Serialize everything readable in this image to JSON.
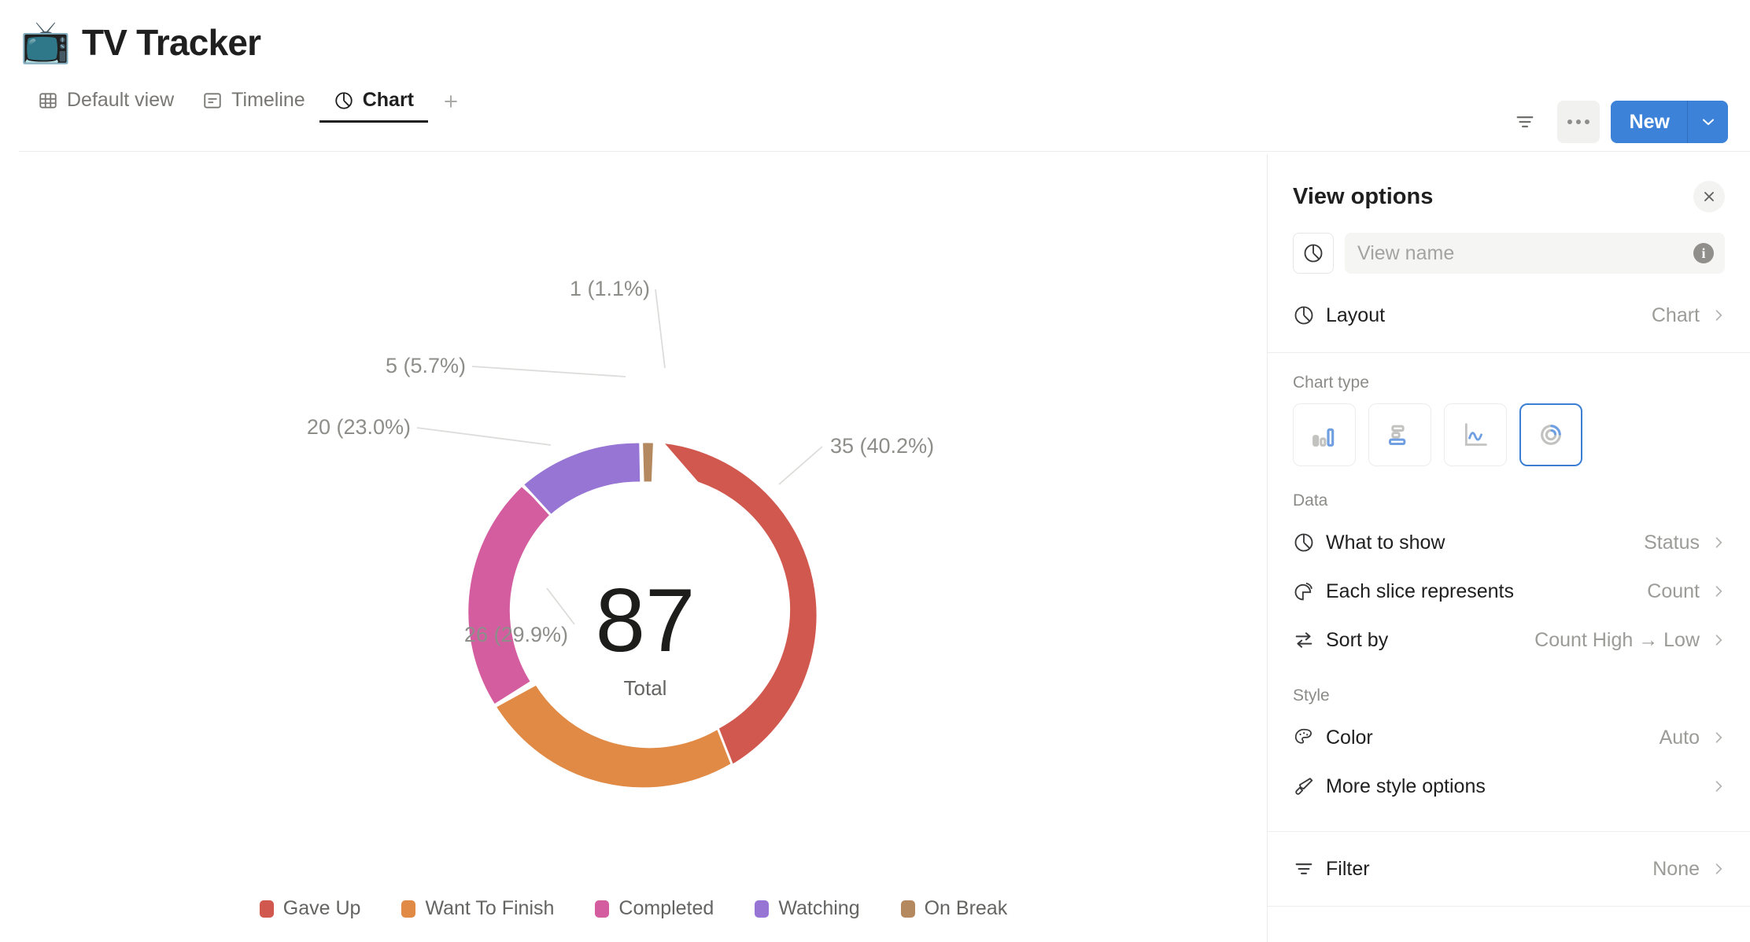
{
  "header": {
    "emoji": "📺",
    "title": "TV Tracker",
    "tabs": [
      {
        "label": "Default view",
        "icon": "table-icon",
        "active": false
      },
      {
        "label": "Timeline",
        "icon": "timeline-icon",
        "active": false
      },
      {
        "label": "Chart",
        "icon": "pie-chart-icon",
        "active": true
      }
    ],
    "add_tab_label": "+",
    "actions": {
      "filter_icon": "filter-icon",
      "more_icon": "more-options-icon",
      "new_label": "New",
      "new_caret_icon": "chevron-down-icon"
    }
  },
  "chart_data": {
    "type": "pie",
    "title": "",
    "subtitle": "",
    "variant": "donut",
    "center_value": "87",
    "center_label": "Total",
    "total": 87,
    "legend_position": "bottom",
    "categories": [
      "Gave Up",
      "Want To Finish",
      "Completed",
      "Watching",
      "On Break"
    ],
    "values": [
      35,
      26,
      20,
      5,
      1
    ],
    "percents": [
      40.2,
      29.9,
      23.0,
      5.7,
      1.1
    ],
    "data_labels": [
      "35 (40.2%)",
      "26 (29.9%)",
      "20 (23.0%)",
      "5 (5.7%)",
      "1 (1.1%)"
    ],
    "colors": [
      "#d1584f",
      "#e08a46",
      "#d45da0",
      "#9775d4",
      "#b5895f"
    ],
    "series": [
      {
        "name": "Count",
        "values": [
          35,
          26,
          20,
          5,
          1
        ]
      }
    ]
  },
  "panel": {
    "title": "View options",
    "close_label": "×",
    "view_name": {
      "value": "",
      "placeholder": "View name",
      "info_label": "i"
    },
    "layout": {
      "label": "Layout",
      "value": "Chart"
    },
    "chart_type": {
      "section_label": "Chart type",
      "options": [
        {
          "name": "column-chart-icon",
          "selected": false
        },
        {
          "name": "bar-chart-icon",
          "selected": false
        },
        {
          "name": "line-chart-icon",
          "selected": false
        },
        {
          "name": "donut-chart-icon",
          "selected": true
        }
      ]
    },
    "data": {
      "section_label": "Data",
      "rows": [
        {
          "label": "What to show",
          "value": "Status",
          "icon": "pie-chart-icon"
        },
        {
          "label": "Each slice represents",
          "value": "Count",
          "icon": "slice-icon"
        },
        {
          "label": "Sort by",
          "value": "Count High → Low",
          "icon": "sort-swap-icon"
        }
      ]
    },
    "style": {
      "section_label": "Style",
      "rows": [
        {
          "label": "Color",
          "value": "Auto",
          "icon": "palette-icon"
        },
        {
          "label": "More style options",
          "value": "",
          "icon": "brush-icon"
        }
      ]
    },
    "filter": {
      "label": "Filter",
      "value": "None",
      "icon": "filter-icon"
    }
  },
  "theme": {
    "accent": "#3b82d8",
    "text": "#1f1f1f",
    "muted": "#9b9b98",
    "border": "#ebebea"
  }
}
